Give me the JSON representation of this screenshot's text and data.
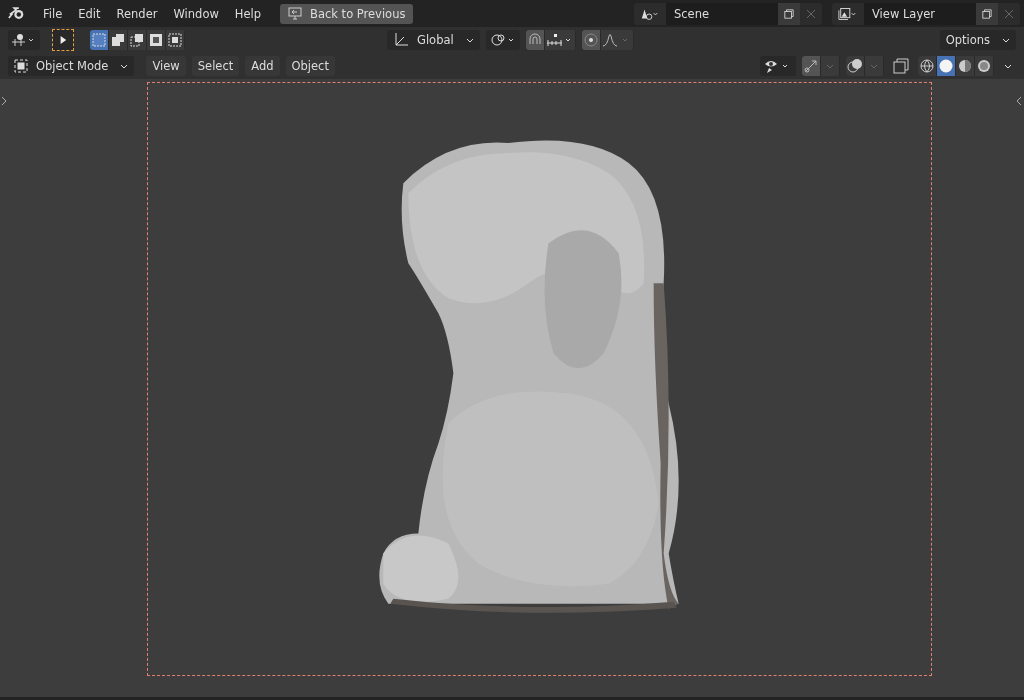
{
  "menu": [
    "File",
    "Edit",
    "Render",
    "Window",
    "Help"
  ],
  "back_button": "Back to Previous",
  "scene": {
    "value": "Scene"
  },
  "view_layer": {
    "value": "View Layer"
  },
  "select_modes": [
    {
      "selected": true
    },
    {
      "selected": false
    },
    {
      "selected": false
    },
    {
      "selected": false
    },
    {
      "selected": false
    }
  ],
  "transform_orientation": "Global",
  "options": "Options",
  "mode": "Object Mode",
  "header_menus": [
    "View",
    "Select",
    "Add",
    "Object"
  ],
  "shading_modes": [
    {
      "kind": "wireframe",
      "selected": false
    },
    {
      "kind": "solid",
      "selected": true
    },
    {
      "kind": "material",
      "selected": false
    },
    {
      "kind": "rendered",
      "selected": false
    }
  ]
}
